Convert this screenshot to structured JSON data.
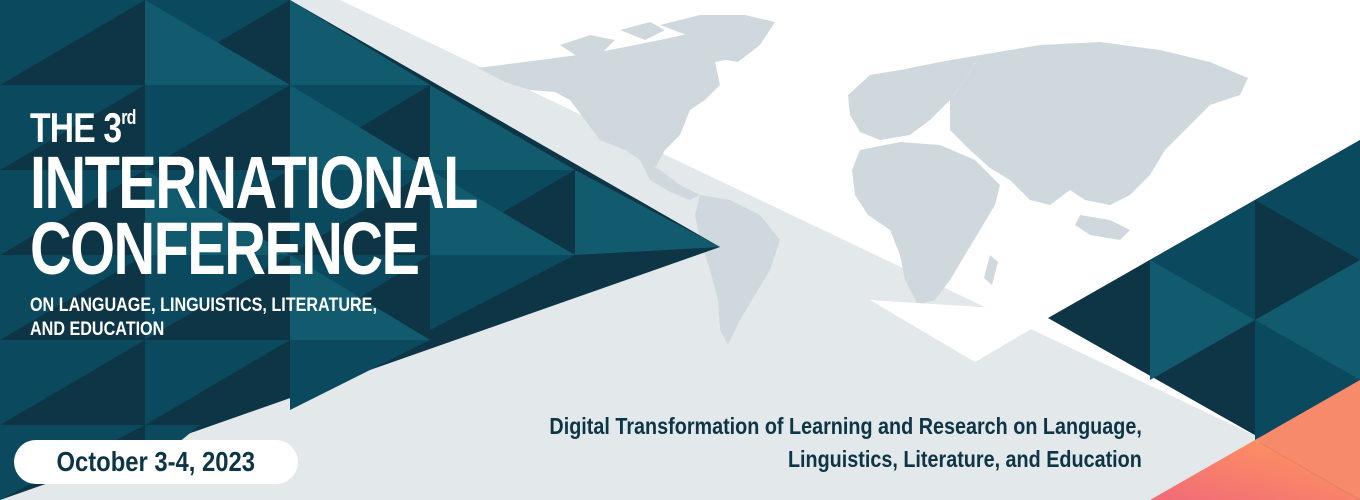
{
  "banner": {
    "title_prefix": "THE 3",
    "title_superscript": "rd",
    "title_line2": "INTERNATIONAL",
    "title_line3": "CONFERENCE",
    "subtitle_line1": "ON LANGUAGE, LINGUISTICS, LITERATURE,",
    "subtitle_line2": "AND EDUCATION",
    "date": "October 3-4, 2023",
    "theme_line1": "Digital Transformation of Learning and Research on Language,",
    "theme_line2": "Linguistics, Literature, and Education"
  },
  "colors": {
    "dark_teal": "#0d3545",
    "teal": "#0b4a5e",
    "mid_teal": "#125a6e",
    "light_grey": "#e3e8ea",
    "map_grey": "#cfd9dd",
    "coral": "#f16a78",
    "orange": "#ff9a5c"
  },
  "icons": [
    "world-map-graphic",
    "triangle-pattern"
  ]
}
